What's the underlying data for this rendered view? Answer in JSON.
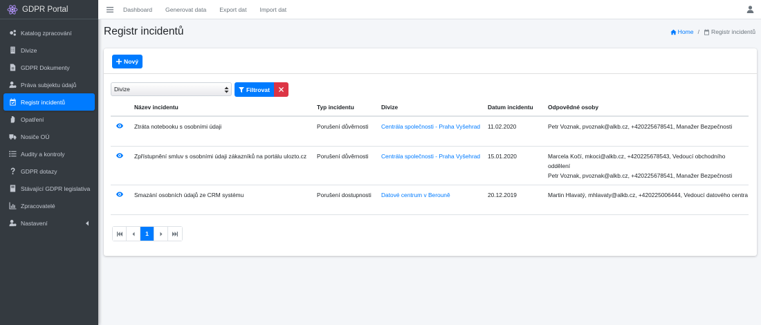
{
  "app": {
    "title": "GDPR Portal"
  },
  "sidebar": {
    "items": [
      {
        "label": "Katalog zpracování",
        "icon": "cogs-icon"
      },
      {
        "label": "Divize",
        "icon": "building-icon"
      },
      {
        "label": "GDPR Dokumenty",
        "icon": "file-icon"
      },
      {
        "label": "Práva subjektu údajů",
        "icon": "user-cog-icon"
      },
      {
        "label": "Registr incidentů",
        "icon": "calendar-check-icon",
        "active": true
      },
      {
        "label": "Opatření",
        "icon": "hand-icon"
      },
      {
        "label": "Nosiče OÚ",
        "icon": "truck-icon"
      },
      {
        "label": "Audity a kontroly",
        "icon": "list-icon"
      },
      {
        "label": "GDPR dotazy",
        "icon": "question-icon"
      },
      {
        "label": "Stávající GDPR legislativa",
        "icon": "book-icon"
      },
      {
        "label": "Zpracovatelé",
        "icon": "chart-icon"
      },
      {
        "label": "Nastavení",
        "icon": "user-gear-icon",
        "has_arrow": true
      }
    ]
  },
  "topbar": {
    "links": [
      "Dashboard",
      "Generovat data",
      "Export dat",
      "Import dat"
    ]
  },
  "page": {
    "title": "Registr incidentů",
    "breadcrumb": {
      "home": "Home",
      "current": "Registr incidentů"
    }
  },
  "toolbar": {
    "new_label": "Nový",
    "select_value": "Divize",
    "filter_label": "Filtrovat"
  },
  "table": {
    "headers": [
      "Název incidentu",
      "Typ incidentu",
      "Divize",
      "Datum incidentu",
      "Odpovědné osoby"
    ],
    "rows": [
      {
        "name": "Ztráta notebooku s osobními údaji",
        "type": "Porušení důvěrnosti",
        "division": "Centrála společnosti - Praha Vyšehrad",
        "date": "11.02.2020",
        "persons": [
          "Petr Voznak, pvoznak@alkb.cz, +420225678541, Manažer Bezpečnosti"
        ]
      },
      {
        "name": "Zpřístupnění smluv s osobními údaji zákazníků na portálu ulozto.cz",
        "type": "Porušení důvěrnosti",
        "division": "Centrála společnosti - Praha Vyšehrad",
        "date": "15.01.2020",
        "persons": [
          "Marcela Kočí, mkoci@alkb.cz, +420225678543, Vedoucí obchodního oddělení",
          "Petr Voznak, pvoznak@alkb.cz, +420225678541, Manažer Bezpečnosti"
        ]
      },
      {
        "name": "Smazání osobních údajů ze CRM systému",
        "type": "Porušení dostupnosti",
        "division": "Datové centrum v Berouně",
        "date": "20.12.2019",
        "persons": [
          "Martin Hlavatý, mhlavaty@alkb.cz, +420225006444, Vedoucí datového centra"
        ]
      }
    ]
  },
  "pagination": {
    "current": "1"
  }
}
